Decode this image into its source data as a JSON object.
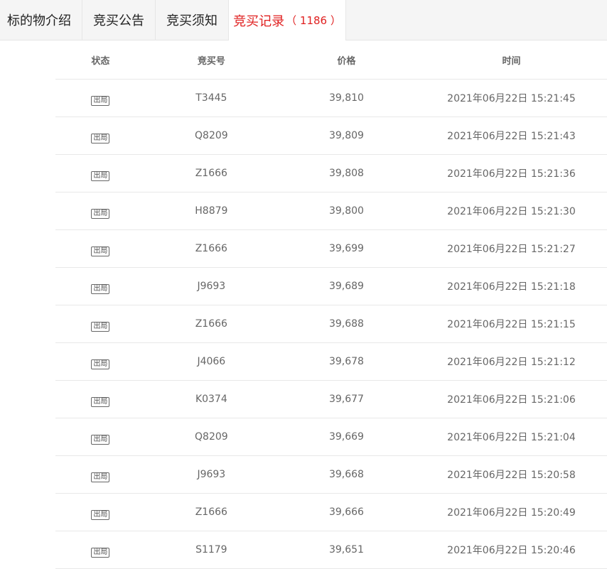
{
  "tabs": [
    {
      "label": "标的物介绍"
    },
    {
      "label": "竞买公告"
    },
    {
      "label": "竞买须知"
    },
    {
      "label": "竞买记录",
      "count": "（ 1186 ）",
      "active": true
    }
  ],
  "table": {
    "headers": {
      "status": "状态",
      "bid_no": "竞买号",
      "price": "价格",
      "time": "时间"
    },
    "rows": [
      {
        "status": "出局",
        "bid_no": "T3445",
        "price": "39,810",
        "time": "2021年06月22日 15:21:45"
      },
      {
        "status": "出局",
        "bid_no": "Q8209",
        "price": "39,809",
        "time": "2021年06月22日 15:21:43"
      },
      {
        "status": "出局",
        "bid_no": "Z1666",
        "price": "39,808",
        "time": "2021年06月22日 15:21:36"
      },
      {
        "status": "出局",
        "bid_no": "H8879",
        "price": "39,800",
        "time": "2021年06月22日 15:21:30"
      },
      {
        "status": "出局",
        "bid_no": "Z1666",
        "price": "39,699",
        "time": "2021年06月22日 15:21:27"
      },
      {
        "status": "出局",
        "bid_no": "J9693",
        "price": "39,689",
        "time": "2021年06月22日 15:21:18"
      },
      {
        "status": "出局",
        "bid_no": "Z1666",
        "price": "39,688",
        "time": "2021年06月22日 15:21:15"
      },
      {
        "status": "出局",
        "bid_no": "J4066",
        "price": "39,678",
        "time": "2021年06月22日 15:21:12"
      },
      {
        "status": "出局",
        "bid_no": "K0374",
        "price": "39,677",
        "time": "2021年06月22日 15:21:06"
      },
      {
        "status": "出局",
        "bid_no": "Q8209",
        "price": "39,669",
        "time": "2021年06月22日 15:21:04"
      },
      {
        "status": "出局",
        "bid_no": "J9693",
        "price": "39,668",
        "time": "2021年06月22日 15:20:58"
      },
      {
        "status": "出局",
        "bid_no": "Z1666",
        "price": "39,666",
        "time": "2021年06月22日 15:20:49"
      },
      {
        "status": "出局",
        "bid_no": "S1179",
        "price": "39,651",
        "time": "2021年06月22日 15:20:46"
      }
    ]
  },
  "colors": {
    "active_tab": "#e02020",
    "tab_bar_bg": "#f5f5f5",
    "text": "#666666"
  }
}
